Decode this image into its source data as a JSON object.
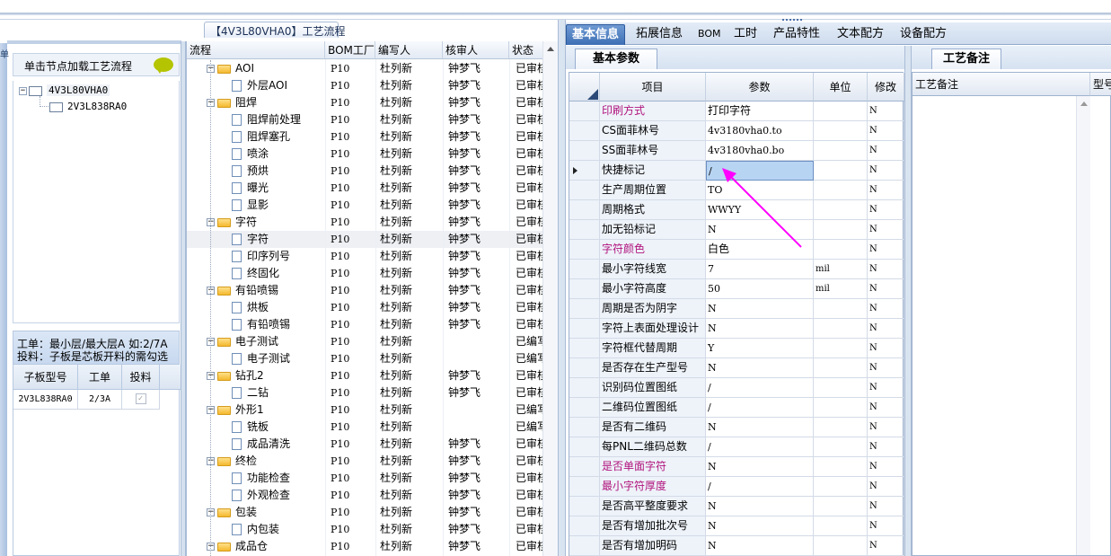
{
  "left": {
    "side_label": "单",
    "load_flow_label": "单击节点加载工艺流程",
    "tree": [
      {
        "label": "4V3L80VHA0",
        "level": 0
      },
      {
        "label": "2V3L838RA0",
        "level": 1
      }
    ],
    "info_line1": "工单：最小层/最大层A 如:2/7A",
    "info_line2": "投料：子板是芯板开料的需勾选",
    "sub_columns": [
      "子板型号",
      "工单",
      "投料"
    ],
    "sub_rows": [
      {
        "model": "2V3L838RA0",
        "order": "2/3A",
        "feed": "✓"
      }
    ]
  },
  "middle": {
    "title": "【4V3L80VHA0】工艺流程",
    "columns": [
      "流程",
      "BOM工厂",
      "编写人",
      "核审人",
      "状态"
    ],
    "rows": [
      {
        "name": "AOI",
        "type": "folder",
        "bom": "P10",
        "writer": "杜列新",
        "reviewer": "钟梦飞",
        "status": "已审核"
      },
      {
        "name": "外层AOI",
        "type": "doc",
        "bom": "P10",
        "writer": "杜列新",
        "reviewer": "钟梦飞",
        "status": "已审核"
      },
      {
        "name": "阻焊",
        "type": "folder",
        "bom": "P10",
        "writer": "杜列新",
        "reviewer": "钟梦飞",
        "status": "已审核"
      },
      {
        "name": "阻焊前处理",
        "type": "doc",
        "bom": "P10",
        "writer": "杜列新",
        "reviewer": "钟梦飞",
        "status": "已审核"
      },
      {
        "name": "阻焊塞孔",
        "type": "doc",
        "bom": "P10",
        "writer": "杜列新",
        "reviewer": "钟梦飞",
        "status": "已审核"
      },
      {
        "name": "喷涂",
        "type": "doc",
        "bom": "P10",
        "writer": "杜列新",
        "reviewer": "钟梦飞",
        "status": "已审核"
      },
      {
        "name": "预烘",
        "type": "doc",
        "bom": "P10",
        "writer": "杜列新",
        "reviewer": "钟梦飞",
        "status": "已审核"
      },
      {
        "name": "曝光",
        "type": "doc",
        "bom": "P10",
        "writer": "杜列新",
        "reviewer": "钟梦飞",
        "status": "已审核"
      },
      {
        "name": "显影",
        "type": "doc",
        "bom": "P10",
        "writer": "杜列新",
        "reviewer": "钟梦飞",
        "status": "已审核"
      },
      {
        "name": "字符",
        "type": "folder",
        "bom": "P10",
        "writer": "杜列新",
        "reviewer": "钟梦飞",
        "status": "已审核"
      },
      {
        "name": "字符",
        "type": "doc",
        "bom": "P10",
        "writer": "杜列新",
        "reviewer": "钟梦飞",
        "status": "已审核",
        "selected": true
      },
      {
        "name": "印序列号",
        "type": "doc",
        "bom": "P10",
        "writer": "杜列新",
        "reviewer": "钟梦飞",
        "status": "已审核"
      },
      {
        "name": "终固化",
        "type": "doc",
        "bom": "P10",
        "writer": "杜列新",
        "reviewer": "钟梦飞",
        "status": "已审核"
      },
      {
        "name": "有铅喷锡",
        "type": "folder",
        "bom": "P10",
        "writer": "杜列新",
        "reviewer": "钟梦飞",
        "status": "已审核"
      },
      {
        "name": "烘板",
        "type": "doc",
        "bom": "P10",
        "writer": "杜列新",
        "reviewer": "钟梦飞",
        "status": "已审核"
      },
      {
        "name": "有铅喷锡",
        "type": "doc",
        "bom": "P10",
        "writer": "杜列新",
        "reviewer": "钟梦飞",
        "status": "已审核"
      },
      {
        "name": "电子测试",
        "type": "folder",
        "bom": "P10",
        "writer": "杜列新",
        "reviewer": "",
        "status": "已编写"
      },
      {
        "name": "电子测试",
        "type": "doc",
        "bom": "P10",
        "writer": "杜列新",
        "reviewer": "",
        "status": "已编写"
      },
      {
        "name": "钻孔2",
        "type": "folder",
        "bom": "P10",
        "writer": "杜列新",
        "reviewer": "钟梦飞",
        "status": "已审核"
      },
      {
        "name": "二钻",
        "type": "doc",
        "bom": "P10",
        "writer": "杜列新",
        "reviewer": "钟梦飞",
        "status": "已审核"
      },
      {
        "name": "外形1",
        "type": "folder",
        "bom": "P10",
        "writer": "杜列新",
        "reviewer": "",
        "status": "已编写"
      },
      {
        "name": "铣板",
        "type": "doc",
        "bom": "P10",
        "writer": "杜列新",
        "reviewer": "",
        "status": "已编写"
      },
      {
        "name": "成品清洗",
        "type": "doc",
        "bom": "P10",
        "writer": "杜列新",
        "reviewer": "钟梦飞",
        "status": "已审核"
      },
      {
        "name": "终检",
        "type": "folder",
        "bom": "P10",
        "writer": "杜列新",
        "reviewer": "钟梦飞",
        "status": "已审核"
      },
      {
        "name": "功能检查",
        "type": "doc",
        "bom": "P10",
        "writer": "杜列新",
        "reviewer": "钟梦飞",
        "status": "已审核"
      },
      {
        "name": "外观检查",
        "type": "doc",
        "bom": "P10",
        "writer": "杜列新",
        "reviewer": "钟梦飞",
        "status": "已审核"
      },
      {
        "name": "包装",
        "type": "folder",
        "bom": "P10",
        "writer": "杜列新",
        "reviewer": "钟梦飞",
        "status": "已审核"
      },
      {
        "name": "内包装",
        "type": "doc",
        "bom": "P10",
        "writer": "杜列新",
        "reviewer": "钟梦飞",
        "status": "已审核"
      },
      {
        "name": "成品仓",
        "type": "folder",
        "bom": "P10",
        "writer": "杜列新",
        "reviewer": "钟梦飞",
        "status": "已审核"
      }
    ]
  },
  "right": {
    "tabs": [
      "基本信息",
      "拓展信息",
      "BOM",
      "工时",
      "产品特性",
      "文本配方",
      "设备配方"
    ],
    "active_tab": 0,
    "params_tab": "基本参数",
    "param_columns": [
      "项目",
      "参数",
      "单位",
      "修改"
    ],
    "params": [
      {
        "item": "印刷方式",
        "value": "打印字符",
        "unit": "",
        "mod": "N",
        "highlight": true
      },
      {
        "item": "CS面菲林号",
        "value": "4v3180vha0.to",
        "unit": "",
        "mod": "N"
      },
      {
        "item": "SS面菲林号",
        "value": "4v3180vha0.bo",
        "unit": "",
        "mod": "N"
      },
      {
        "item": "快捷标记",
        "value": "/",
        "unit": "",
        "mod": "N",
        "current": true
      },
      {
        "item": "生产周期位置",
        "value": "TO",
        "unit": "",
        "mod": "N"
      },
      {
        "item": "周期格式",
        "value": "WWYY",
        "unit": "",
        "mod": "N"
      },
      {
        "item": "加无铅标记",
        "value": "N",
        "unit": "",
        "mod": "N"
      },
      {
        "item": "字符颜色",
        "value": "白色",
        "unit": "",
        "mod": "N",
        "highlight": true
      },
      {
        "item": "最小字符线宽",
        "value": "7",
        "unit": "mil",
        "mod": "N"
      },
      {
        "item": "最小字符高度",
        "value": "50",
        "unit": "mil",
        "mod": "N"
      },
      {
        "item": "周期是否为阴字",
        "value": "N",
        "unit": "",
        "mod": "N"
      },
      {
        "item": "字符上表面处理设计",
        "value": "N",
        "unit": "",
        "mod": "N"
      },
      {
        "item": "字符框代替周期",
        "value": "Y",
        "unit": "",
        "mod": "N"
      },
      {
        "item": "是否存在生产型号",
        "value": "N",
        "unit": "",
        "mod": "N"
      },
      {
        "item": "识别码位置图纸",
        "value": "/",
        "unit": "",
        "mod": "N"
      },
      {
        "item": "二维码位置图纸",
        "value": "/",
        "unit": "",
        "mod": "N"
      },
      {
        "item": "是否有二维码",
        "value": "N",
        "unit": "",
        "mod": "N"
      },
      {
        "item": "每PNL二维码总数",
        "value": "/",
        "unit": "",
        "mod": "N"
      },
      {
        "item": "是否单面字符",
        "value": "N",
        "unit": "",
        "mod": "N",
        "highlight": true
      },
      {
        "item": "最小字符厚度",
        "value": "/",
        "unit": "",
        "mod": "N",
        "highlight": true
      },
      {
        "item": "是否高平整度要求",
        "value": "N",
        "unit": "",
        "mod": "N"
      },
      {
        "item": "是否有增加批次号",
        "value": "N",
        "unit": "",
        "mod": "N"
      },
      {
        "item": "是否有增加明码",
        "value": "N",
        "unit": "",
        "mod": "N"
      }
    ],
    "notes_tab": "工艺备注",
    "notes_columns": [
      "工艺备注",
      "型号"
    ]
  },
  "colors": {
    "highlight_text": "#b0137c",
    "arrow": "#ff00ff",
    "active_tab": "#3d6fb5"
  }
}
